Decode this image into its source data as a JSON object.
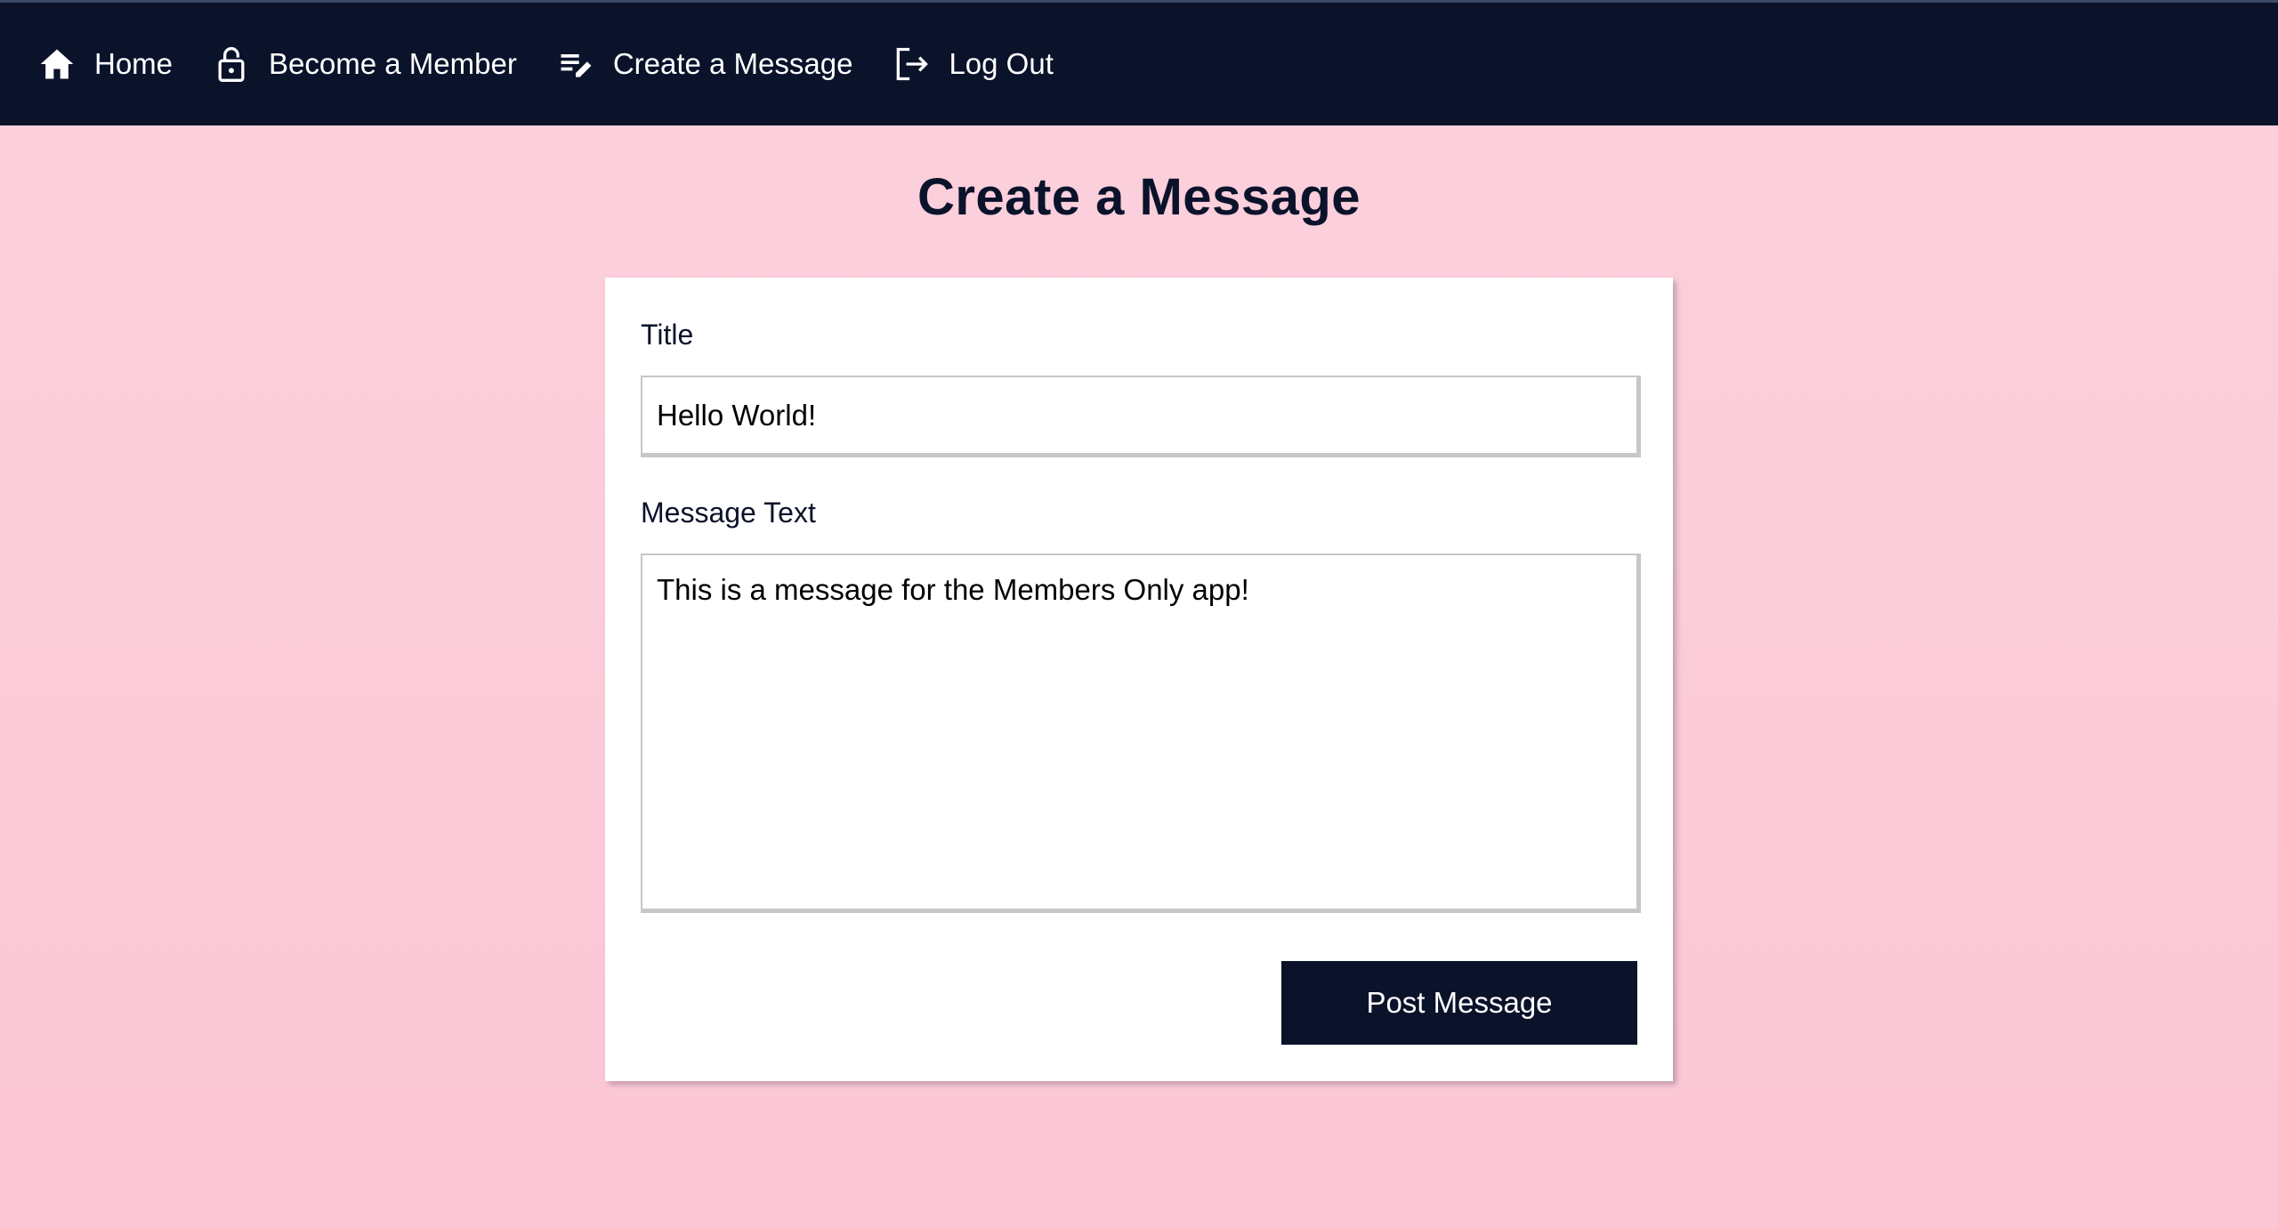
{
  "nav": {
    "items": [
      {
        "label": "Home",
        "icon": "home-icon"
      },
      {
        "label": "Become a Member",
        "icon": "lock-icon"
      },
      {
        "label": "Create a Message",
        "icon": "edit-note-icon"
      },
      {
        "label": "Log Out",
        "icon": "logout-icon"
      }
    ]
  },
  "page": {
    "title": "Create a Message"
  },
  "form": {
    "title_label": "Title",
    "title_value": "Hello World!",
    "message_label": "Message Text",
    "message_value": "This is a message for the Members Only app!",
    "submit_label": "Post Message"
  },
  "colors": {
    "navbar": "#0b132b",
    "background": "#fbcbd8",
    "button": "#0b132b",
    "card": "#ffffff"
  }
}
